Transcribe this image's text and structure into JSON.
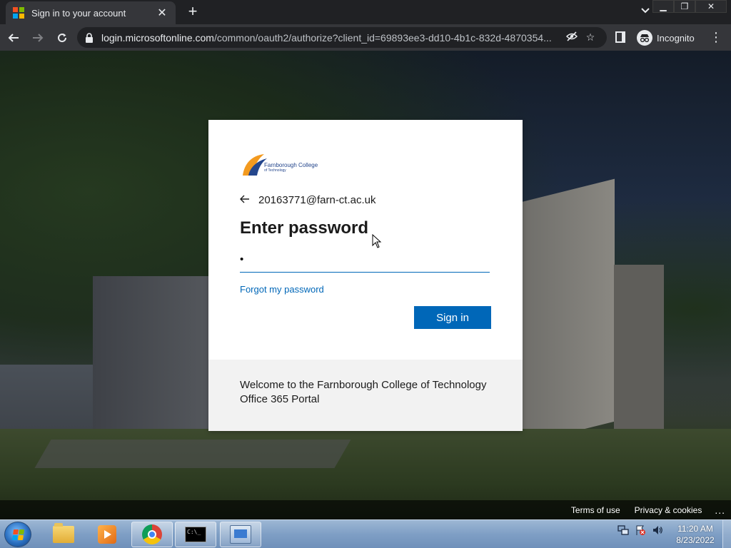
{
  "browser": {
    "tab_title": "Sign in to your account",
    "new_tab_symbol": "+",
    "tab_close_symbol": "✕",
    "url_host": "login.microsoftonline.com",
    "url_rest": "/common/oauth2/authorize?client_id=69893ee3-dd10-4b1c-832d-4870354...",
    "profile_label": "Incognito",
    "colors": {
      "tab_bg": "#35363a",
      "frame_bg": "#202124"
    }
  },
  "signin": {
    "org_name_line1": "Farnborough College",
    "org_name_line2": "of Technology",
    "identity": "20163771@farn-ct.ac.uk",
    "heading": "Enter password",
    "password_value": "•",
    "forgot_link": "Forgot my password",
    "signin_button": "Sign in",
    "footer_text": "Welcome to the Farnborough College of Technology Office 365 Portal",
    "colors": {
      "accent": "#0067b8",
      "card_bg": "#ffffff",
      "footer_bg": "#f2f2f2"
    }
  },
  "page_footer": {
    "terms": "Terms of use",
    "privacy": "Privacy & cookies",
    "more": "..."
  },
  "taskbar": {
    "clock_time": "11:20 AM",
    "clock_date": "8/23/2022",
    "pinned": [
      "explorer-icon",
      "media-player-icon",
      "chrome-icon",
      "cmd-icon",
      "remote-desktop-icon"
    ]
  }
}
